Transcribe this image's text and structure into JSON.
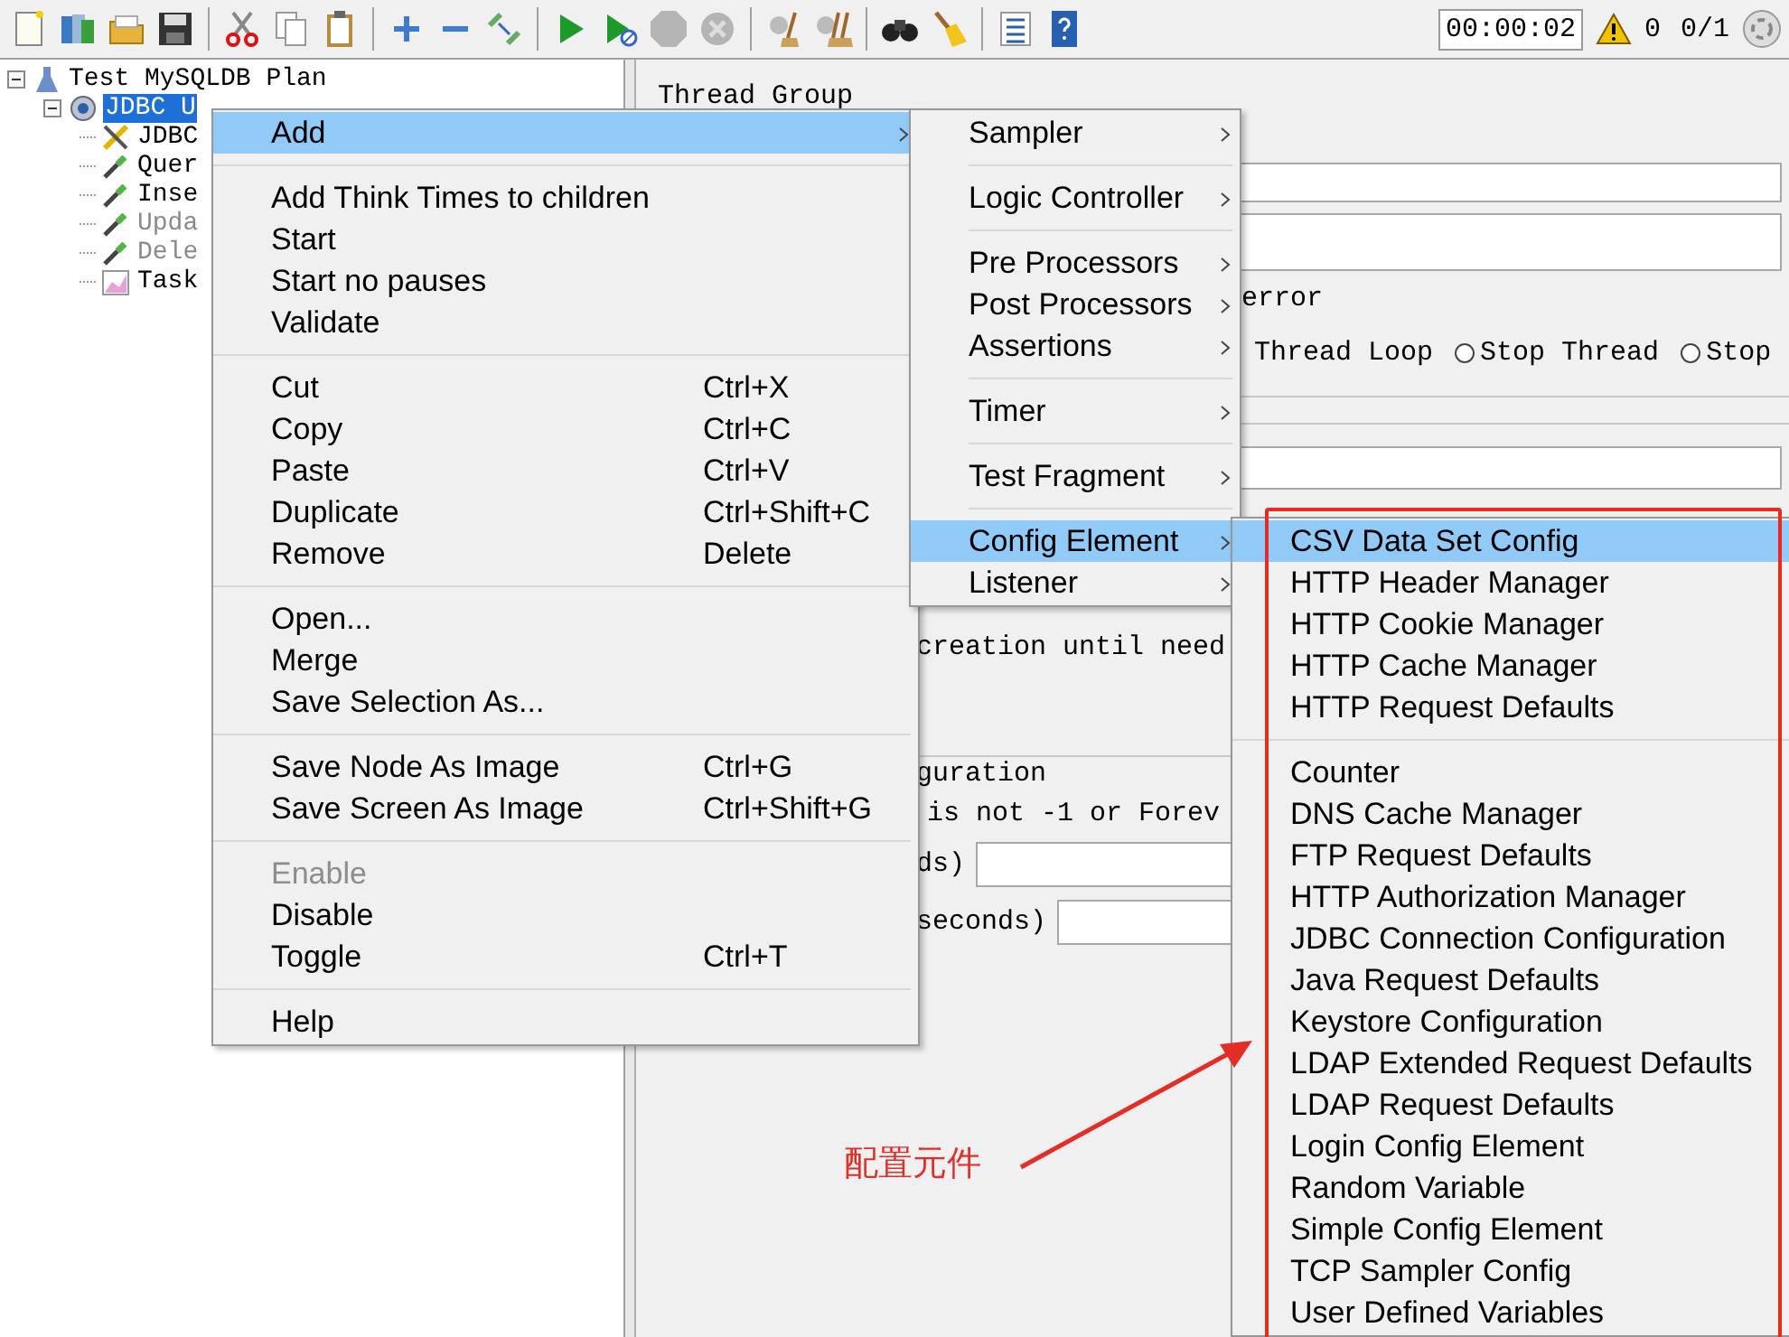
{
  "toolbar": {
    "timer": "00:00:02",
    "error_count": "0",
    "threads": "0/1"
  },
  "tree": [
    {
      "label": "Test MySQLDB Plan",
      "kind": "plan",
      "expanded": true,
      "selected": false,
      "children": [
        {
          "label": "JDBC U",
          "kind": "thread-group",
          "expanded": true,
          "selected": true,
          "children": [
            {
              "label": "JDBC",
              "kind": "config",
              "selected": false,
              "disabled": false
            },
            {
              "label": "Quer",
              "kind": "sampler",
              "selected": false,
              "disabled": false
            },
            {
              "label": "Inse",
              "kind": "sampler",
              "selected": false,
              "disabled": false
            },
            {
              "label": "Upda",
              "kind": "sampler",
              "selected": false,
              "disabled": true
            },
            {
              "label": "Dele",
              "kind": "sampler",
              "selected": false,
              "disabled": true
            },
            {
              "label": "Task",
              "kind": "listener",
              "selected": false,
              "disabled": false
            }
          ]
        }
      ]
    }
  ],
  "editor": {
    "title": "Thread Group",
    "error_legend": "error",
    "action_fragment": "Thread Loop",
    "radios": [
      {
        "label": "Stop Thread",
        "selected": false
      },
      {
        "label": "Stop",
        "selected": false
      }
    ],
    "delay_fragment": "creation until need",
    "scheduler_legend": "guration",
    "loop_note": "is not -1 or Forev",
    "duration_label": "ds)",
    "startup_delay_label": "seconds)"
  },
  "context_menu": {
    "groups": [
      [
        {
          "label": "Add",
          "selected": true,
          "disabled": false,
          "submenu": true
        }
      ],
      [
        {
          "label": "Add Think Times to children",
          "selected": false,
          "disabled": false,
          "submenu": false
        },
        {
          "label": "Start",
          "selected": false,
          "disabled": false,
          "submenu": false
        },
        {
          "label": "Start no pauses",
          "selected": false,
          "disabled": false,
          "submenu": false
        },
        {
          "label": "Validate",
          "selected": false,
          "disabled": false,
          "submenu": false
        }
      ],
      [
        {
          "label": "Cut",
          "shortcut": "Ctrl+X",
          "selected": false,
          "disabled": false,
          "submenu": false
        },
        {
          "label": "Copy",
          "shortcut": "Ctrl+C",
          "selected": false,
          "disabled": false,
          "submenu": false
        },
        {
          "label": "Paste",
          "shortcut": "Ctrl+V",
          "selected": false,
          "disabled": false,
          "submenu": false
        },
        {
          "label": "Duplicate",
          "shortcut": "Ctrl+Shift+C",
          "selected": false,
          "disabled": false,
          "submenu": false
        },
        {
          "label": "Remove",
          "shortcut": "Delete",
          "selected": false,
          "disabled": false,
          "submenu": false
        }
      ],
      [
        {
          "label": "Open...",
          "selected": false,
          "disabled": false,
          "submenu": false
        },
        {
          "label": "Merge",
          "selected": false,
          "disabled": false,
          "submenu": false
        },
        {
          "label": "Save Selection As...",
          "selected": false,
          "disabled": false,
          "submenu": false
        }
      ],
      [
        {
          "label": "Save Node As Image",
          "shortcut": "Ctrl+G",
          "selected": false,
          "disabled": false,
          "submenu": false
        },
        {
          "label": "Save Screen As Image",
          "shortcut": "Ctrl+Shift+G",
          "selected": false,
          "disabled": false,
          "submenu": false
        }
      ],
      [
        {
          "label": "Enable",
          "selected": false,
          "disabled": true,
          "submenu": false
        },
        {
          "label": "Disable",
          "selected": false,
          "disabled": false,
          "submenu": false
        },
        {
          "label": "Toggle",
          "shortcut": "Ctrl+T",
          "selected": false,
          "disabled": false,
          "submenu": false
        }
      ],
      [
        {
          "label": "Help",
          "selected": false,
          "disabled": false,
          "submenu": false
        }
      ]
    ]
  },
  "add_menu": {
    "groups": [
      [
        {
          "label": "Sampler",
          "selected": false,
          "submenu": true
        }
      ],
      [
        {
          "label": "Logic Controller",
          "selected": false,
          "submenu": true
        }
      ],
      [
        {
          "label": "Pre Processors",
          "selected": false,
          "submenu": true
        },
        {
          "label": "Post Processors",
          "selected": false,
          "submenu": true
        },
        {
          "label": "Assertions",
          "selected": false,
          "submenu": true
        }
      ],
      [
        {
          "label": "Timer",
          "selected": false,
          "submenu": true
        }
      ],
      [
        {
          "label": "Test Fragment",
          "selected": false,
          "submenu": true
        }
      ],
      [
        {
          "label": "Config Element",
          "selected": true,
          "submenu": true
        },
        {
          "label": "Listener",
          "selected": false,
          "submenu": true
        }
      ]
    ]
  },
  "config_menu": {
    "groups": [
      [
        {
          "label": "CSV Data Set Config",
          "selected": true
        },
        {
          "label": "HTTP Header Manager",
          "selected": false
        },
        {
          "label": "HTTP Cookie Manager",
          "selected": false
        },
        {
          "label": "HTTP Cache Manager",
          "selected": false
        },
        {
          "label": "HTTP Request Defaults",
          "selected": false
        }
      ],
      [
        {
          "label": "Counter",
          "selected": false
        },
        {
          "label": "DNS Cache Manager",
          "selected": false
        },
        {
          "label": "FTP Request Defaults",
          "selected": false
        },
        {
          "label": "HTTP Authorization Manager",
          "selected": false
        },
        {
          "label": "JDBC Connection Configuration",
          "selected": false
        },
        {
          "label": "Java Request Defaults",
          "selected": false
        },
        {
          "label": "Keystore Configuration",
          "selected": false
        },
        {
          "label": "LDAP Extended Request Defaults",
          "selected": false
        },
        {
          "label": "LDAP Request Defaults",
          "selected": false
        },
        {
          "label": "Login Config Element",
          "selected": false
        },
        {
          "label": "Random Variable",
          "selected": false
        },
        {
          "label": "Simple Config Element",
          "selected": false
        },
        {
          "label": "TCP Sampler Config",
          "selected": false
        },
        {
          "label": "User Defined Variables",
          "selected": false
        }
      ]
    ]
  },
  "annotation": {
    "label": "配置元件"
  }
}
